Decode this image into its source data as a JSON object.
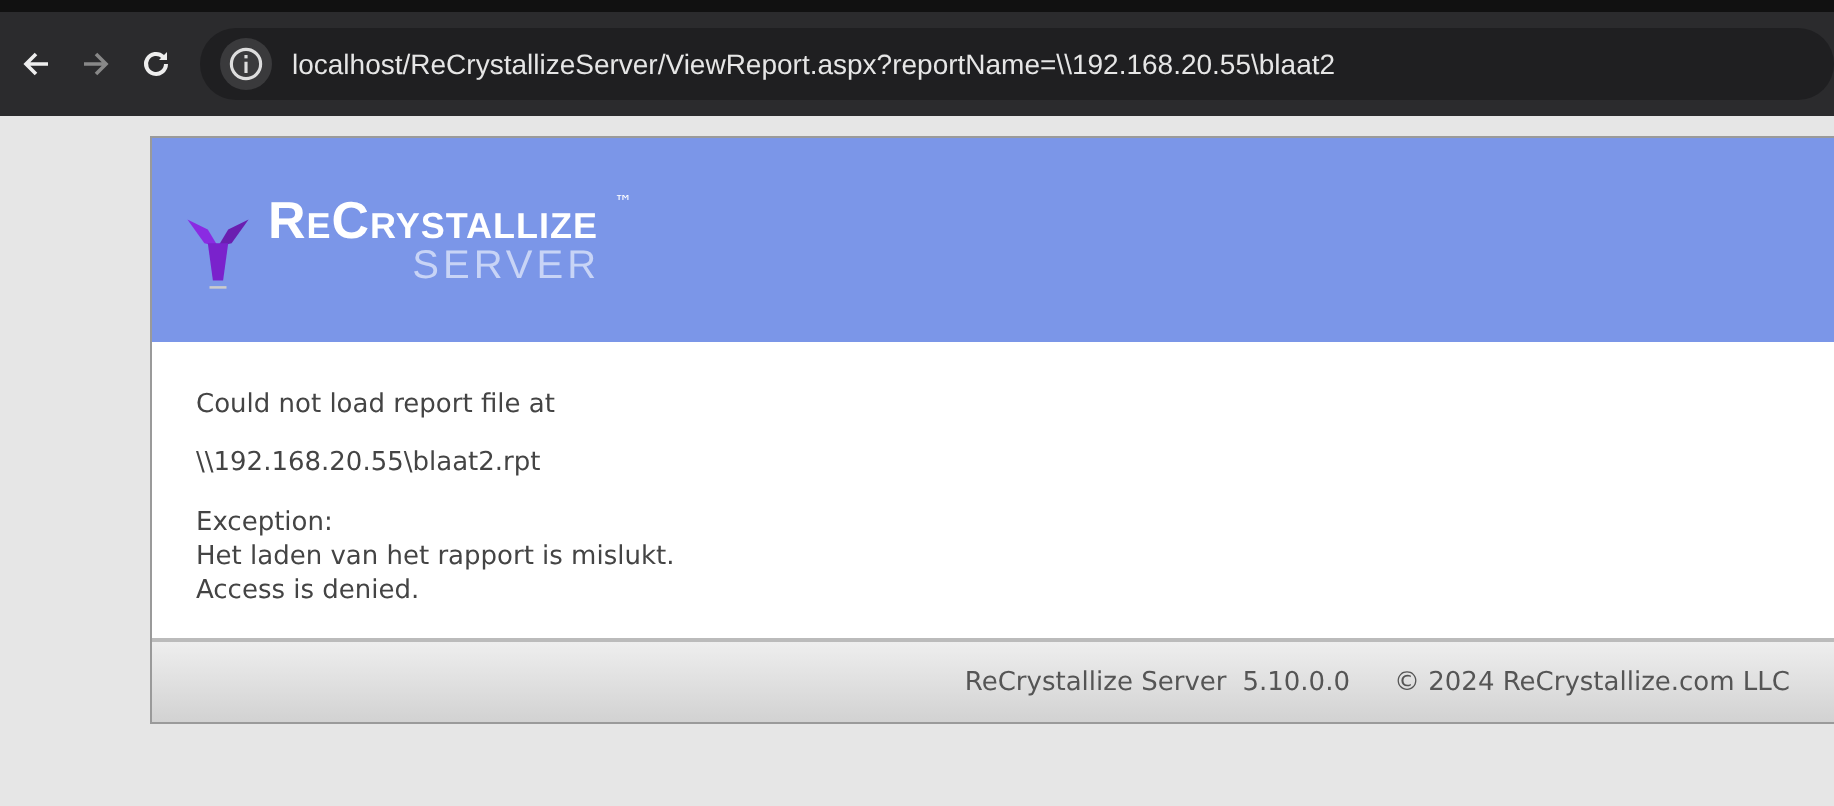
{
  "browser": {
    "url": "localhost/ReCrystallizeServer/ViewReport.aspx?reportName=\\\\192.168.20.55\\blaat2"
  },
  "header": {
    "brand": "ReCrystallize",
    "trademark": "™",
    "subtitle": "SERVER"
  },
  "message": {
    "lines": [
      "Could not load report file at",
      "\\\\192.168.20.55\\blaat2.rpt"
    ],
    "exception_label": "Exception:",
    "exception_lines": [
      "Het laden van het rapport is mislukt.",
      "Access is denied."
    ]
  },
  "footer": {
    "product": "ReCrystallize Server",
    "version": "5.10.0.0",
    "copyright": "© 2024 ReCrystallize.com LLC"
  }
}
